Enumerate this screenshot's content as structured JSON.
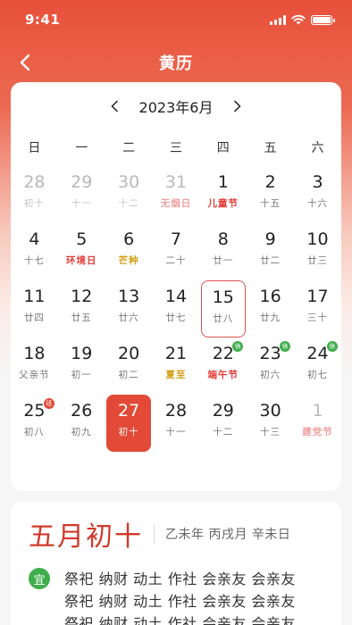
{
  "status_bar": {
    "time": "9:41"
  },
  "nav": {
    "title": "黄历"
  },
  "calendar": {
    "month_label": "2023年6月",
    "weekdays": [
      "日",
      "一",
      "二",
      "三",
      "四",
      "五",
      "六"
    ],
    "days": [
      {
        "num": "28",
        "sub": "初十",
        "other": true
      },
      {
        "num": "29",
        "sub": "十一",
        "other": true
      },
      {
        "num": "30",
        "sub": "十二",
        "other": true
      },
      {
        "num": "31",
        "sub": "无烟日",
        "other": true,
        "type": "festival"
      },
      {
        "num": "1",
        "sub": "儿童节",
        "type": "festival"
      },
      {
        "num": "2",
        "sub": "十五"
      },
      {
        "num": "3",
        "sub": "十六"
      },
      {
        "num": "4",
        "sub": "十七"
      },
      {
        "num": "5",
        "sub": "环境日",
        "type": "festival"
      },
      {
        "num": "6",
        "sub": "芒种",
        "type": "term"
      },
      {
        "num": "7",
        "sub": "二十"
      },
      {
        "num": "8",
        "sub": "廿一"
      },
      {
        "num": "9",
        "sub": "廿二"
      },
      {
        "num": "10",
        "sub": "廿三"
      },
      {
        "num": "11",
        "sub": "廿四"
      },
      {
        "num": "12",
        "sub": "廿五"
      },
      {
        "num": "13",
        "sub": "廿六"
      },
      {
        "num": "14",
        "sub": "廿七"
      },
      {
        "num": "15",
        "sub": "廿八",
        "today": true
      },
      {
        "num": "16",
        "sub": "廿九"
      },
      {
        "num": "17",
        "sub": "三十"
      },
      {
        "num": "18",
        "sub": "父亲节"
      },
      {
        "num": "19",
        "sub": "初一"
      },
      {
        "num": "20",
        "sub": "初二"
      },
      {
        "num": "21",
        "sub": "夏至",
        "type": "term"
      },
      {
        "num": "22",
        "sub": "端午节",
        "type": "festival",
        "badge": "休",
        "badge_type": "rest"
      },
      {
        "num": "23",
        "sub": "初六",
        "badge": "休",
        "badge_type": "rest"
      },
      {
        "num": "24",
        "sub": "初七",
        "badge": "休",
        "badge_type": "rest"
      },
      {
        "num": "25",
        "sub": "初八",
        "badge": "班",
        "badge_type": "work"
      },
      {
        "num": "26",
        "sub": "初九"
      },
      {
        "num": "27",
        "sub": "初十",
        "selected": true
      },
      {
        "num": "28",
        "sub": "十一"
      },
      {
        "num": "29",
        "sub": "十二"
      },
      {
        "num": "30",
        "sub": "十三"
      },
      {
        "num": "1",
        "sub": "建党节",
        "other": true,
        "type": "festival"
      }
    ]
  },
  "lunar": {
    "date": "五月初十",
    "ganzhi": "乙未年 丙戌月 辛未日",
    "yi_label": "宜",
    "yi_lines": [
      "祭祀 纳财 动土 作社 会亲友 会亲友",
      "祭祀 纳财 动土 作社 会亲友 会亲友",
      "祭祀 纳财 动土 作社 会亲友 会亲友"
    ]
  },
  "colors": {
    "accent": "#e24a37",
    "rest_badge": "#3fae4c",
    "festival": "#e53935",
    "solar_term": "#d4a017"
  }
}
